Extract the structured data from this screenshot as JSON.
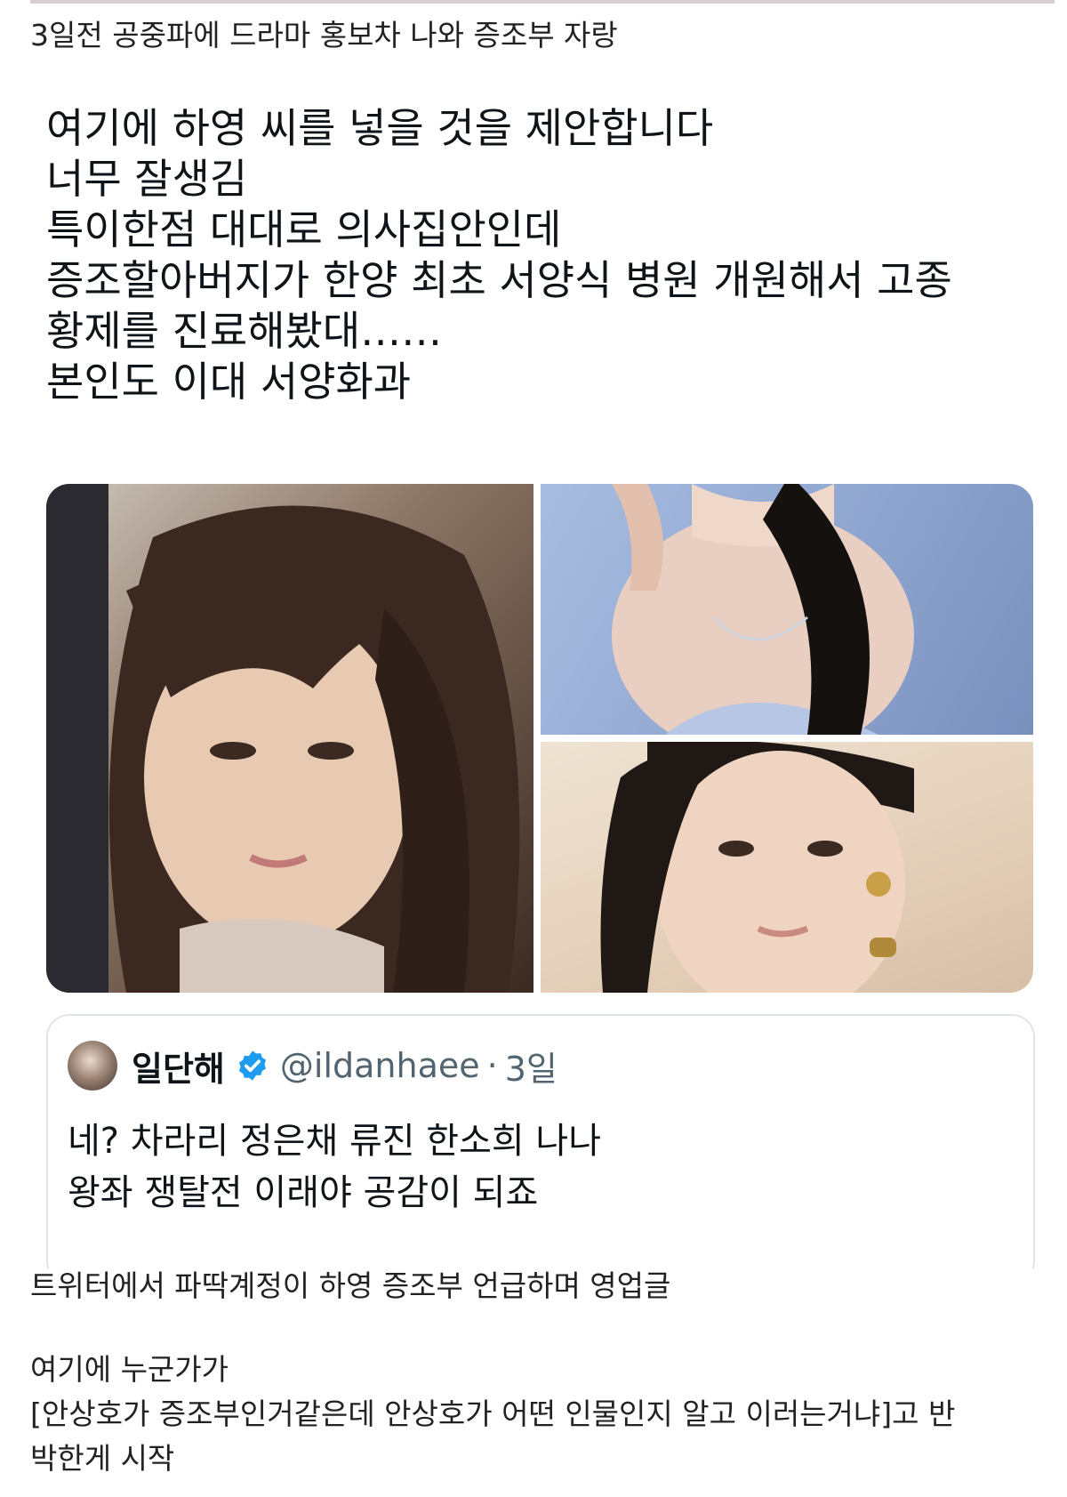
{
  "captions": {
    "top": "3일전 공중파에 드라마 홍보차 나와 증조부 자랑",
    "middle": "트위터에서 파딱계정이 하영 증조부 언급하며 영업글",
    "bottom": [
      "여기에 누군가가",
      "[안상호가 증조부인거같은데 안상호가 어떤 인물인지 알고 이러는거냐]고 반",
      "박한게 시작"
    ]
  },
  "tweet": {
    "lines": [
      "여기에 하영 씨를 넣을 것을 제안합니다",
      "너무 잘생김",
      "특이한점 대대로 의사집안인데",
      "증조할아버지가 한양 최초 서양식 병원 개원해서 고종",
      "황제를 진료해봤대……",
      "본인도 이대 서양화과"
    ],
    "media": [
      {
        "name": "photo-left",
        "kind": "portrait photo"
      },
      {
        "name": "photo-top-right",
        "kind": "portrait photo"
      },
      {
        "name": "photo-bottom-right",
        "kind": "portrait photo"
      }
    ],
    "quote": {
      "name": "일단해",
      "verified_icon": "verified-badge-icon",
      "handle": "@ildanhaee",
      "dot": "·",
      "time": "3일",
      "lines": [
        "네? 차라리 정은채 류진 한소희 나나",
        "왕좌 쟁탈전 이래야 공감이 되죠"
      ]
    }
  },
  "colors": {
    "text": "#222222",
    "tweet_text": "#0f1419",
    "secondary": "#536471",
    "verified": "#1d9bf0",
    "card_border": "#e1e5e8"
  }
}
